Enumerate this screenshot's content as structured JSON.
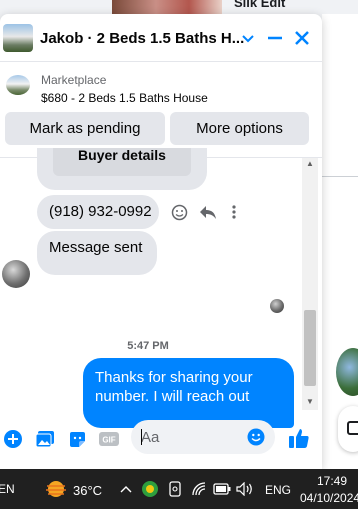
{
  "background": {
    "top_text": "Silk Edit"
  },
  "chat": {
    "title": "Jakob · 2 Beds 1.5 Baths H...",
    "marketplace_label": "Marketplace",
    "listing": "$680 - 2 Beds 1.5 Baths House",
    "buttons": {
      "mark_pending": "Mark as pending",
      "more_options": "More options"
    },
    "messages": {
      "buyer_details": "Buyer details",
      "phone": "(918) 932-0992",
      "sent_notice": "Message sent",
      "timestamp": "5:47 PM",
      "outgoing": "Thanks for sharing your number.  I will reach out"
    },
    "composer": {
      "placeholder": "Aa"
    },
    "colors": {
      "accent": "#0084ff",
      "bubble_in": "#e4e6eb"
    }
  },
  "taskbar": {
    "temperature": "36°C",
    "language": "ENG",
    "time": "17:49",
    "date": "04/10/2024",
    "left_fragment": "EN"
  }
}
